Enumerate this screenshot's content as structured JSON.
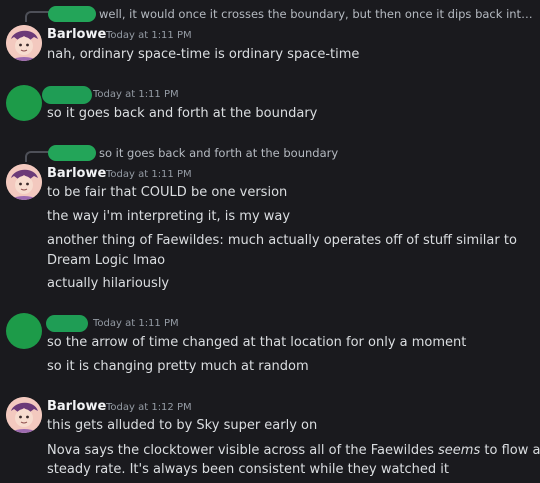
{
  "colors": {
    "background": "#1a1a1e",
    "text": "#dbdee1",
    "muted": "#949ba4",
    "username": "#f2f3f5",
    "hidden_name_green": "#23a559",
    "avatar_green": "#1d9b49",
    "avatar_barlowe": "#f3c9bf"
  },
  "messages": [
    {
      "reply": "well, it would once it crosses the boundary, but then once it dips back into the ...",
      "author": "Barlowe",
      "timestamp": "Today at 1:11 PM",
      "lines": [
        "nah, ordinary space-time is ordinary space-time"
      ]
    },
    {
      "author": "",
      "timestamp": "Today at 1:11 PM",
      "lines": [
        "so it goes back and forth at the boundary"
      ]
    },
    {
      "reply": "so it goes back and forth at the boundary",
      "author": "Barlowe",
      "timestamp": "Today at 1:11 PM",
      "lines": [
        "to be fair that COULD be one version",
        "the way i'm interpreting it, is my way",
        "another thing of Faewildes: much actually operates off of stuff similar to",
        "Dream Logic lmao",
        "actually hilariously"
      ]
    },
    {
      "author": "",
      "timestamp": "Today at 1:11 PM",
      "lines": [
        "so the arrow of time changed at that location for only a moment",
        "so it is changing pretty much at random"
      ]
    },
    {
      "author": "Barlowe",
      "timestamp": "Today at 1:12 PM",
      "lines": [
        "this gets alluded to by Sky super early on"
      ],
      "rich_line": {
        "before": "Nova says the clocktower visible across all of the Faewildes ",
        "emphasis": "seems",
        "after": " to flow at a"
      },
      "tail_line": "steady rate. It's always been consistent while they watched it"
    }
  ]
}
